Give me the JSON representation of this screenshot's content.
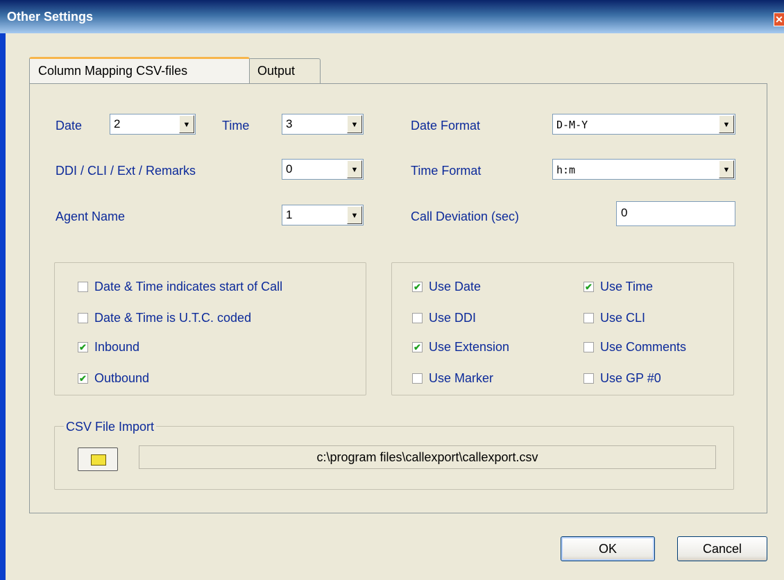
{
  "window": {
    "title": "Other Settings",
    "close_glyph": "✕"
  },
  "tabs": [
    {
      "label": "Column Mapping CSV-files",
      "active": true
    },
    {
      "label": "Output",
      "active": false
    }
  ],
  "mapping": {
    "date_label": "Date",
    "date_value": "2",
    "time_label": "Time",
    "time_value": "3",
    "ddi_label": "DDI / CLI / Ext / Remarks",
    "ddi_value": "0",
    "agent_label": "Agent Name",
    "agent_value": "1",
    "date_format_label": "Date Format",
    "date_format_value": "D-M-Y",
    "time_format_label": "Time Format",
    "time_format_value": "h:m",
    "call_dev_label": "Call Deviation (sec)",
    "call_dev_value": "0"
  },
  "left_options": [
    {
      "label": "Date & Time indicates start of Call",
      "checked": false
    },
    {
      "label": "Date & Time is U.T.C. coded",
      "checked": false
    },
    {
      "label": "Inbound",
      "checked": true
    },
    {
      "label": "Outbound",
      "checked": true
    }
  ],
  "right_options": [
    {
      "label": "Use Date",
      "checked": true
    },
    {
      "label": "Use Time",
      "checked": true
    },
    {
      "label": "Use DDI",
      "checked": false
    },
    {
      "label": "Use CLI",
      "checked": false
    },
    {
      "label": "Use Extension",
      "checked": true
    },
    {
      "label": "Use Comments",
      "checked": false
    },
    {
      "label": "Use Marker",
      "checked": false
    },
    {
      "label": "Use GP #0",
      "checked": false
    }
  ],
  "csv_import": {
    "legend": "CSV File Import",
    "path": "c:\\program files\\callexport\\callexport.csv",
    "browse_icon": "folder-icon"
  },
  "buttons": {
    "ok": "OK",
    "cancel": "Cancel"
  },
  "check_glyph": "✔",
  "dropdown_glyph": "▼",
  "colors": {
    "accent_tab": "#F7B54B",
    "label_blue": "#0C2A9A",
    "title_blue": "#0A246A"
  }
}
